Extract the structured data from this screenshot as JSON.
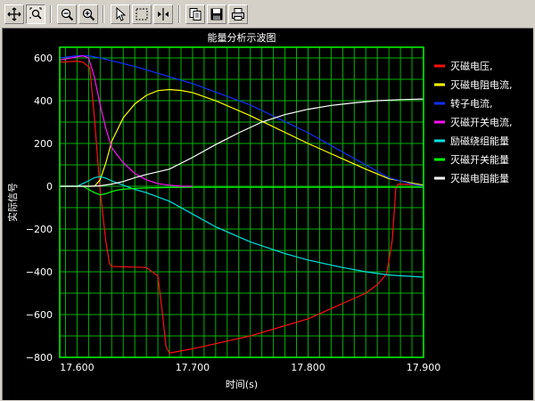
{
  "toolbar": {
    "icons": [
      "move-icon",
      "zoom-area-icon",
      "zoom-out-icon",
      "zoom-in-icon",
      "select-cursor-icon",
      "select-box-icon",
      "split-cursor-icon",
      "copy-icon",
      "save-icon",
      "print-icon"
    ]
  },
  "colors": {
    "background": "#000000",
    "plot_border": "#00ff00",
    "grid": "#00b400",
    "text": "#ffffff"
  },
  "chart_data": {
    "type": "line",
    "title": "能量分析示波图",
    "xlabel": "时间(s)",
    "ylabel": "实际信号",
    "xlim": [
      17.585,
      17.9
    ],
    "ylim": [
      -800,
      650
    ],
    "x_ticks": [
      17.6,
      17.7,
      17.8,
      17.9
    ],
    "x_tick_labels": [
      "17.600",
      "17.700",
      "17.800",
      "17.900"
    ],
    "y_ticks": [
      600,
      400,
      200,
      0,
      -200,
      -400,
      -600,
      -800
    ],
    "y_tick_labels": [
      "600",
      "400",
      "200",
      "0",
      "−200",
      "−400",
      "−600",
      "−800"
    ],
    "grid": true,
    "legend_position": "right",
    "series": [
      {
        "name": "灭磁电压,",
        "color": "#ff1010",
        "x": [
          17.585,
          17.6,
          17.605,
          17.611,
          17.615,
          17.62,
          17.625,
          17.628,
          17.63,
          17.66,
          17.67,
          17.674,
          17.677,
          17.68,
          17.685,
          17.7,
          17.75,
          17.8,
          17.85,
          17.86,
          17.868,
          17.873,
          17.876,
          17.878,
          17.88,
          17.9
        ],
        "y": [
          580,
          585,
          580,
          555,
          320,
          -20,
          -260,
          -360,
          -375,
          -380,
          -420,
          -600,
          -750,
          -780,
          -775,
          -760,
          -700,
          -620,
          -500,
          -460,
          -410,
          -250,
          -10,
          10,
          10,
          5
        ]
      },
      {
        "name": "灭磁电阻电流,",
        "color": "#ffff00",
        "x": [
          17.585,
          17.61,
          17.615,
          17.62,
          17.625,
          17.63,
          17.64,
          17.65,
          17.66,
          17.67,
          17.68,
          17.69,
          17.7,
          17.72,
          17.75,
          17.8,
          17.85,
          17.87,
          17.9
        ],
        "y": [
          0,
          0,
          0,
          30,
          110,
          210,
          320,
          385,
          425,
          447,
          452,
          448,
          438,
          400,
          330,
          200,
          80,
          35,
          5
        ]
      },
      {
        "name": "转子电流,",
        "color": "#1030ff",
        "x": [
          17.585,
          17.6,
          17.61,
          17.62,
          17.65,
          17.7,
          17.75,
          17.8,
          17.85,
          17.87,
          17.89,
          17.9
        ],
        "y": [
          600,
          610,
          610,
          600,
          560,
          480,
          380,
          250,
          100,
          40,
          10,
          0
        ]
      },
      {
        "name": "灭磁开关电流,",
        "color": "#ff10ff",
        "x": [
          17.585,
          17.605,
          17.61,
          17.615,
          17.62,
          17.625,
          17.63,
          17.64,
          17.65,
          17.66,
          17.67,
          17.68,
          17.69,
          17.7
        ],
        "y": [
          590,
          610,
          600,
          510,
          380,
          270,
          180,
          110,
          60,
          30,
          12,
          5,
          0,
          0
        ]
      },
      {
        "name": "励磁绕组能量",
        "color": "#00e0e0",
        "x": [
          17.585,
          17.6,
          17.61,
          17.615,
          17.62,
          17.625,
          17.63,
          17.64,
          17.65,
          17.66,
          17.68,
          17.7,
          17.72,
          17.75,
          17.78,
          17.8,
          17.83,
          17.85,
          17.87,
          17.9
        ],
        "y": [
          0,
          0,
          25,
          40,
          45,
          38,
          25,
          5,
          -15,
          -30,
          -70,
          -130,
          -190,
          -260,
          -315,
          -345,
          -380,
          -400,
          -415,
          -425
        ]
      },
      {
        "name": "灭磁开关能量",
        "color": "#00ff00",
        "x": [
          17.585,
          17.605,
          17.61,
          17.615,
          17.62,
          17.625,
          17.63,
          17.635,
          17.64,
          17.65,
          17.66,
          17.68,
          17.7,
          17.75,
          17.8,
          17.85,
          17.9
        ],
        "y": [
          0,
          0,
          -15,
          -30,
          -40,
          -35,
          -25,
          -18,
          -14,
          -10,
          -8,
          -6,
          -5,
          -5,
          -5,
          -5,
          -5
        ]
      },
      {
        "name": "灭磁电阻能量",
        "color": "#ffffff",
        "x": [
          17.585,
          17.61,
          17.62,
          17.63,
          17.64,
          17.65,
          17.66,
          17.68,
          17.7,
          17.72,
          17.74,
          17.76,
          17.78,
          17.8,
          17.82,
          17.84,
          17.86,
          17.88,
          17.9
        ],
        "y": [
          0,
          0,
          2,
          10,
          22,
          40,
          55,
          80,
          135,
          195,
          250,
          300,
          335,
          360,
          378,
          390,
          400,
          405,
          408
        ]
      }
    ]
  }
}
